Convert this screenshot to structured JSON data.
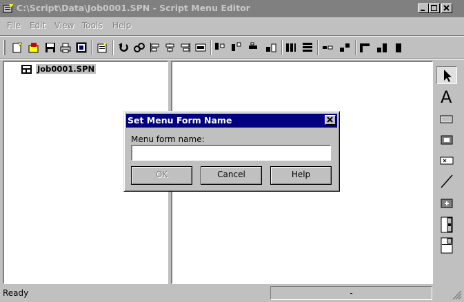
{
  "window": {
    "title": "C:\\Script\\Data\\Job0001.SPN - Script Menu Editor"
  },
  "menubar": {
    "items": [
      "File",
      "Edit",
      "View",
      "Tools",
      "Help"
    ]
  },
  "toolbar": {
    "icons": [
      "new-icon",
      "open-icon",
      "save-icon",
      "print-icon",
      "preview-icon",
      "form-properties-icon",
      "undo-icon",
      "redo-icon",
      "align-left-icon",
      "align-center-icon",
      "align-right-icon",
      "align-grid-icon",
      "align-top-icon",
      "align-middle-icon",
      "align-bottom-icon",
      "same-size-icon",
      "space-horizontal-icon",
      "space-vertical-icon",
      "move-icon",
      "tab-order-icon",
      "bring-front-icon",
      "send-back-icon"
    ]
  },
  "tree": {
    "root_label": "Job0001.SPN"
  },
  "palette": {
    "tools": [
      "pointer-tool-icon",
      "text-tool-icon",
      "rectangle-tool-icon",
      "button-tool-icon",
      "field-tool-icon",
      "line-tool-icon",
      "checkbox-tool-icon",
      "list-tool-icon",
      "combo-tool-icon"
    ]
  },
  "status": {
    "left": "Ready",
    "panel": "-"
  },
  "dialog": {
    "title": "Set Menu Form Name",
    "label": "Menu form name:",
    "input_value": "",
    "ok_label": "OK",
    "cancel_label": "Cancel",
    "help_label": "Help"
  }
}
